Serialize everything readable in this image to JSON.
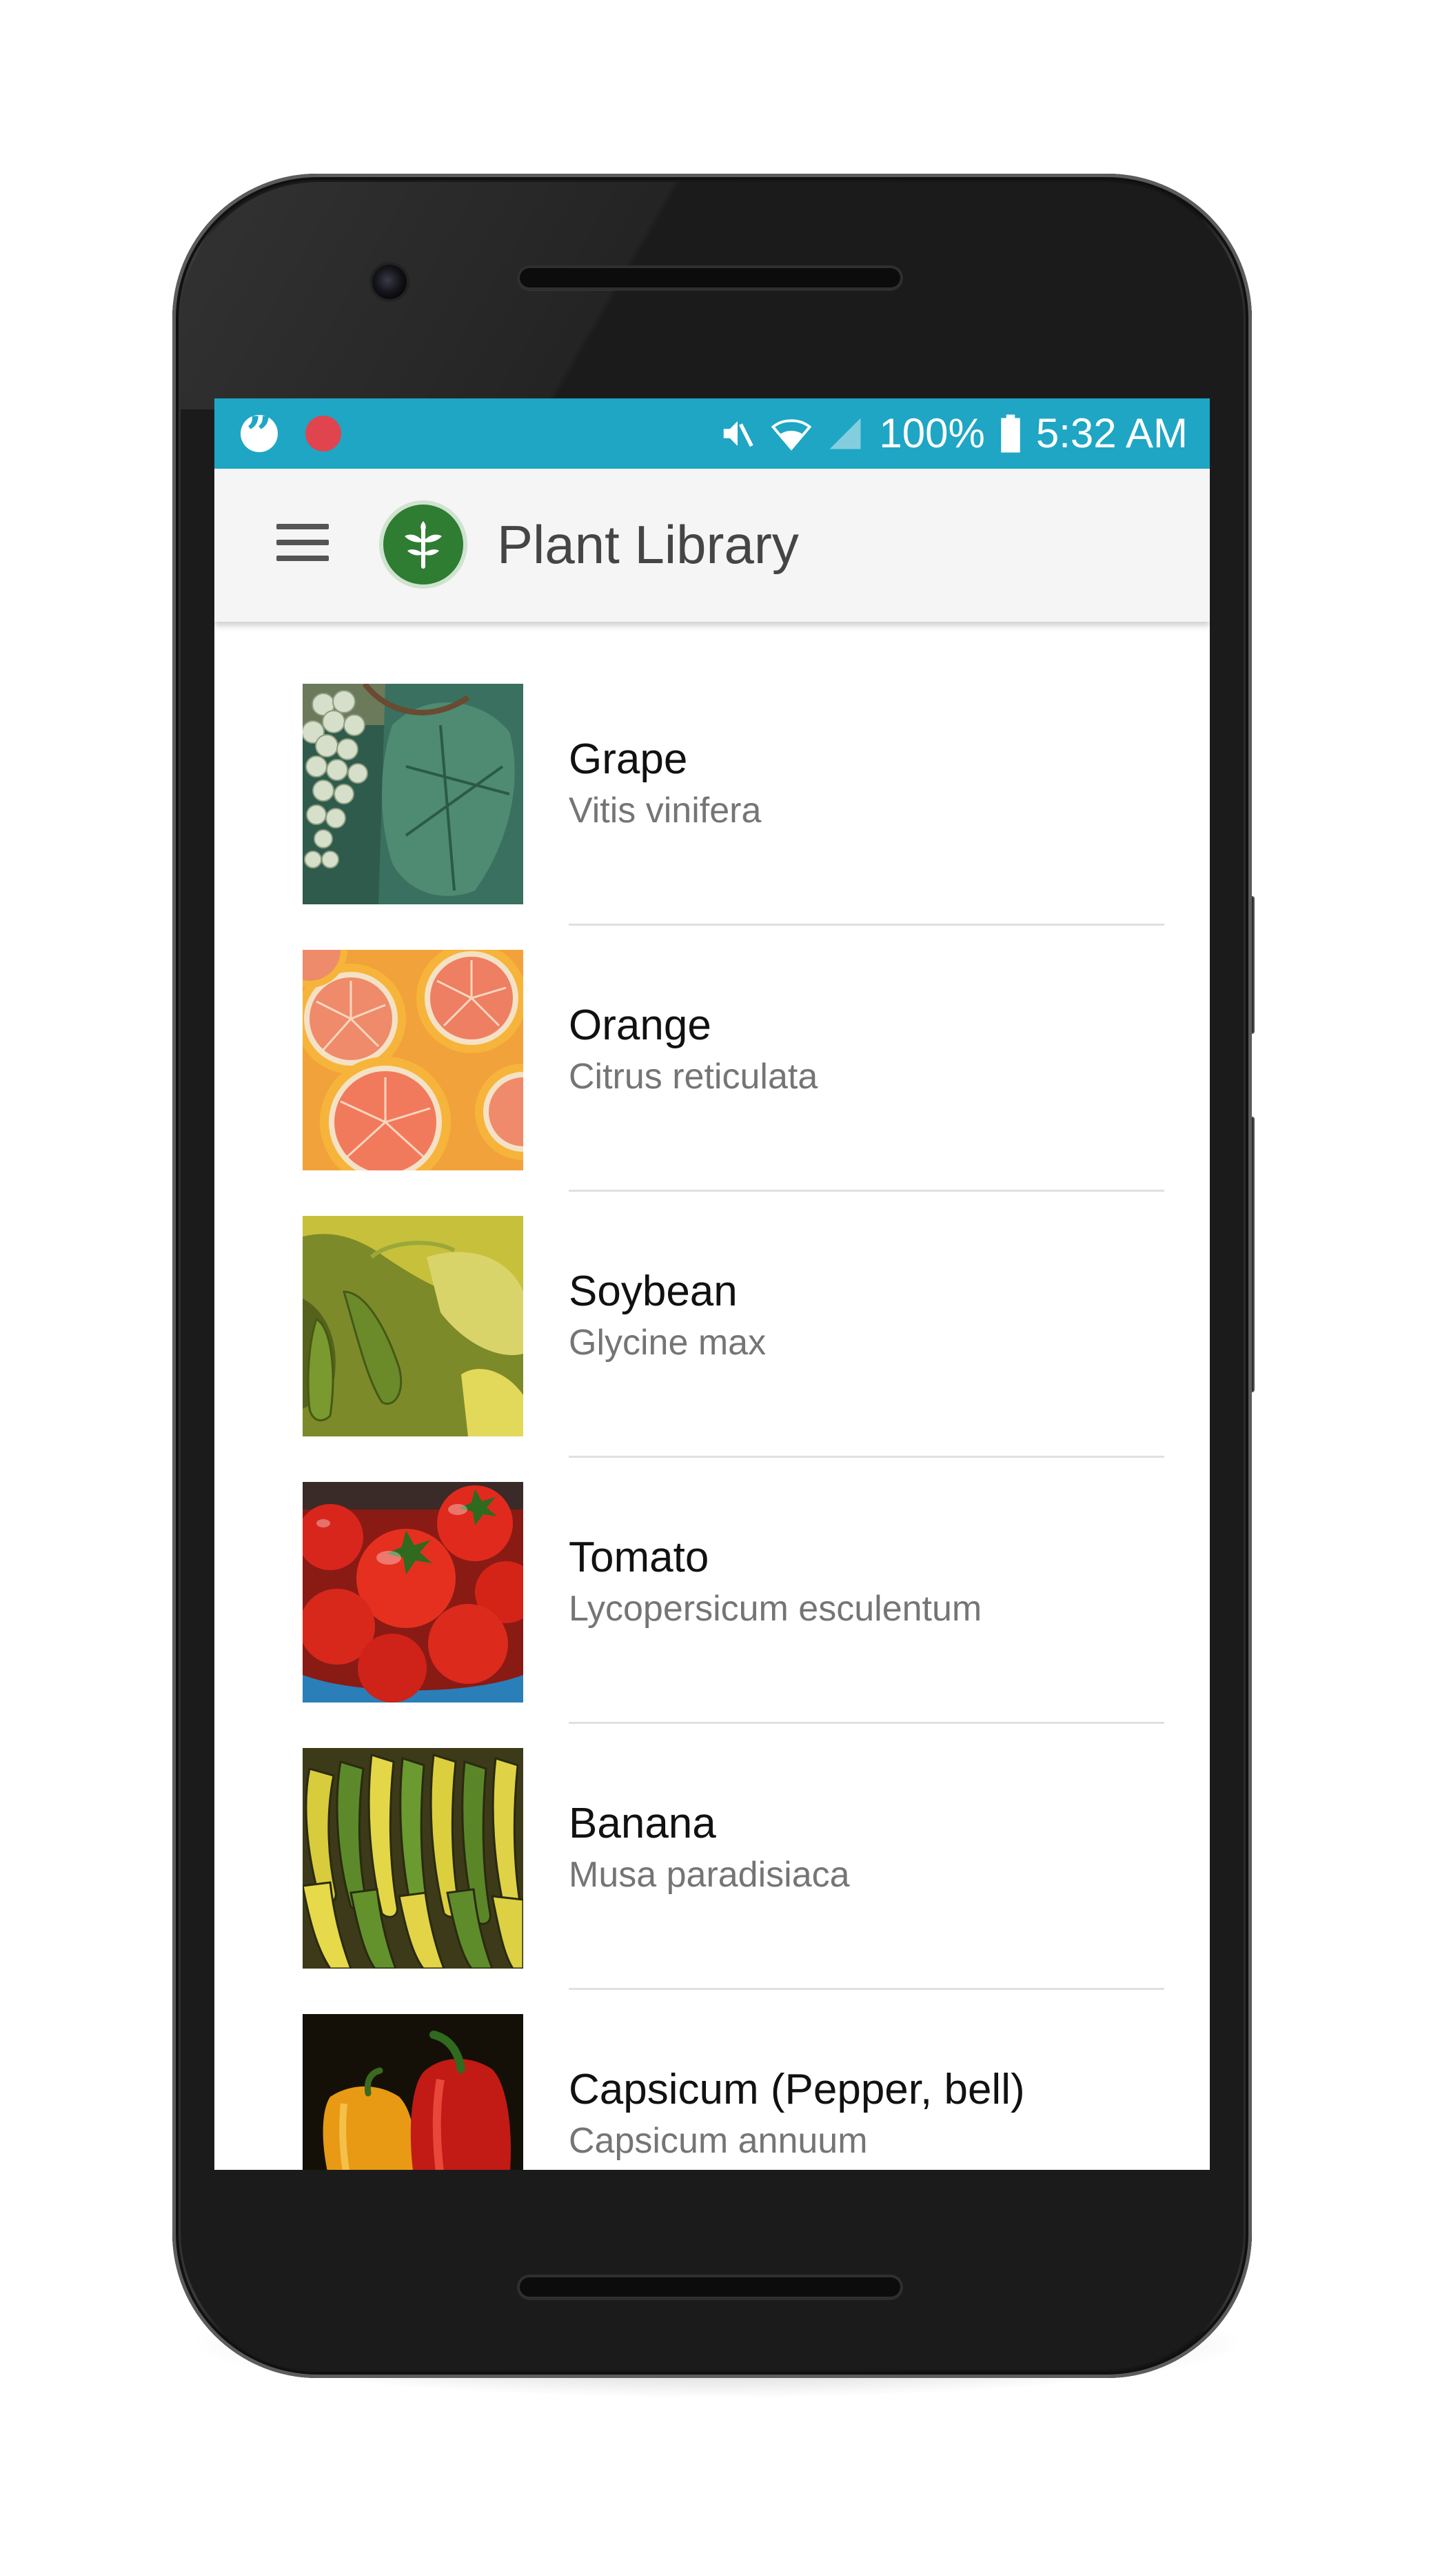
{
  "status_bar": {
    "battery": "100%",
    "time": "5:32 AM",
    "left_icons": [
      "hangouts-icon",
      "record-icon"
    ],
    "right_icons": [
      "mute-icon",
      "wifi-icon",
      "signal-icon",
      "battery-icon"
    ]
  },
  "app_bar": {
    "title": "Plant Library",
    "menu_icon": "hamburger-menu-icon",
    "logo_icon": "plant-logo-icon"
  },
  "colors": {
    "status_bar": "#1ea6c4",
    "app_bar": "#f5f5f5",
    "logo": "#2e7d32",
    "primary_text": "#111111",
    "secondary_text": "#757575"
  },
  "plants": [
    {
      "name": "Grape",
      "scientific": "Vitis vinifera",
      "image": "grape-photo"
    },
    {
      "name": "Orange",
      "scientific": "Citrus reticulata",
      "image": "orange-photo"
    },
    {
      "name": "Soybean",
      "scientific": "Glycine max",
      "image": "soybean-photo"
    },
    {
      "name": "Tomato",
      "scientific": "Lycopersicum esculentum",
      "image": "tomato-photo"
    },
    {
      "name": "Banana",
      "scientific": "Musa paradisiaca",
      "image": "banana-photo"
    },
    {
      "name": "Capsicum (Pepper, bell)",
      "scientific": "Capsicum annuum",
      "image": "capsicum-photo"
    }
  ]
}
